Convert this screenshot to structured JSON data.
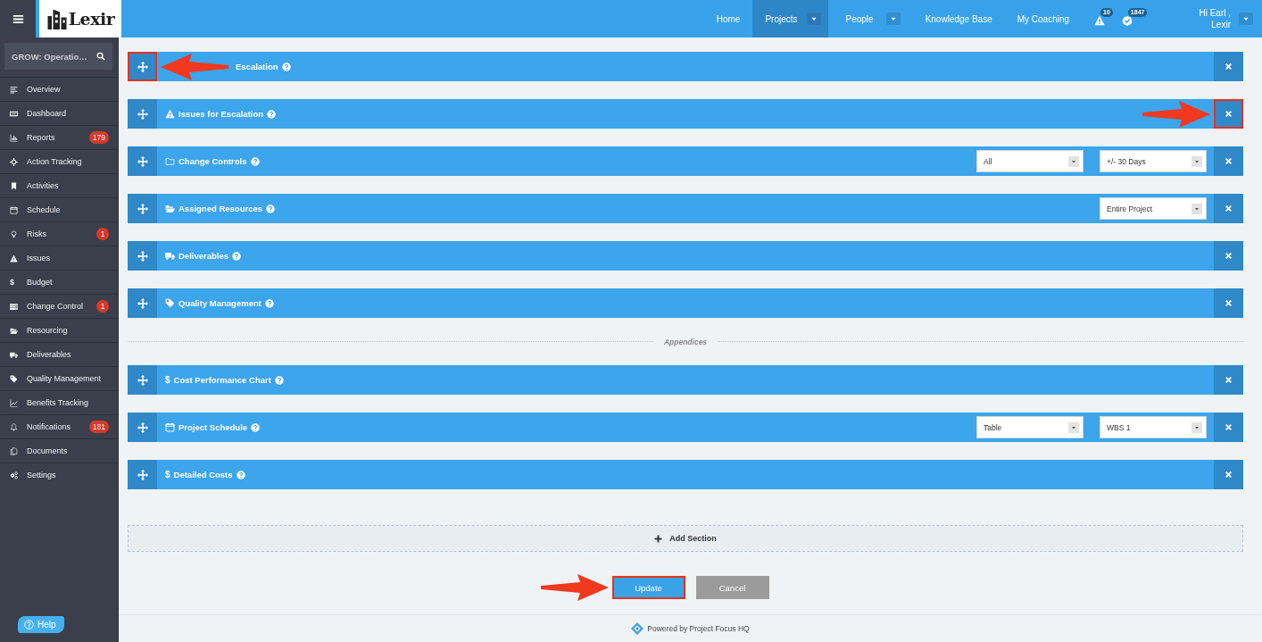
{
  "topbar": {
    "logo_text": "Lexir",
    "nav": [
      {
        "label": "Home",
        "selected": false,
        "dropdown": false
      },
      {
        "label": "Projects",
        "selected": true,
        "dropdown": true
      },
      {
        "label": "People",
        "selected": false,
        "dropdown": true
      },
      {
        "label": "Knowledge Base",
        "selected": false,
        "dropdown": false
      },
      {
        "label": "My Coaching",
        "selected": false,
        "dropdown": false
      }
    ],
    "alerts": [
      {
        "count": "10"
      },
      {
        "count": "1847"
      }
    ],
    "user": {
      "greeting": "Hi Earl ,",
      "name": "Lexir"
    }
  },
  "sidebar": {
    "search": {
      "value": "GROW: Operatio…"
    },
    "items": [
      {
        "label": "Overview"
      },
      {
        "label": "Dashboard"
      },
      {
        "label": "Reports",
        "badge": "179"
      },
      {
        "label": "Action Tracking"
      },
      {
        "label": "Activities"
      },
      {
        "label": "Schedule"
      },
      {
        "label": "Risks",
        "badge": "1"
      },
      {
        "label": "Issues"
      },
      {
        "label": "Budget",
        "glyph": "$"
      },
      {
        "label": "Change Control",
        "badge": "1"
      },
      {
        "label": "Resourcing"
      },
      {
        "label": "Deliverables"
      },
      {
        "label": "Quality Management"
      },
      {
        "label": "Benefits Tracking"
      },
      {
        "label": "Notifications",
        "badge": "181"
      },
      {
        "label": "Documents"
      },
      {
        "label": "Settings"
      }
    ],
    "help": "Help"
  },
  "sections": [
    {
      "title": "Escalation",
      "handle_highlighted": true,
      "close_highlighted": false
    },
    {
      "title": "Issues for Escalation",
      "handle_highlighted": false,
      "close_highlighted": true
    },
    {
      "title": "Change Controls",
      "filters": [
        "All",
        "+/- 30 Days"
      ],
      "handle_highlighted": false,
      "close_highlighted": false
    },
    {
      "title": "Assigned Resources",
      "filters": [
        "Entire Project"
      ],
      "handle_highlighted": false,
      "close_highlighted": false
    },
    {
      "title": "Deliverables",
      "handle_highlighted": false,
      "close_highlighted": false
    },
    {
      "title": "Quality Management",
      "handle_highlighted": false,
      "close_highlighted": false
    }
  ],
  "appendices": {
    "label": "Appendices",
    "sections": [
      {
        "title": "Cost Performance Chart",
        "glyph": "$",
        "handle_highlighted": false,
        "close_highlighted": false
      },
      {
        "title": "Project Schedule",
        "filters": [
          "Table",
          "WBS 1"
        ],
        "handle_highlighted": false,
        "close_highlighted": false
      },
      {
        "title": "Detailed Costs",
        "glyph": "$",
        "handle_highlighted": false,
        "close_highlighted": false
      }
    ]
  },
  "add_section": "Add Section",
  "buttons": [
    {
      "label": "Update",
      "kind": "primary",
      "highlighted": true
    },
    {
      "label": "Cancel",
      "kind": "secondary",
      "highlighted": false
    }
  ],
  "footer": "Powered by Project Focus HQ"
}
